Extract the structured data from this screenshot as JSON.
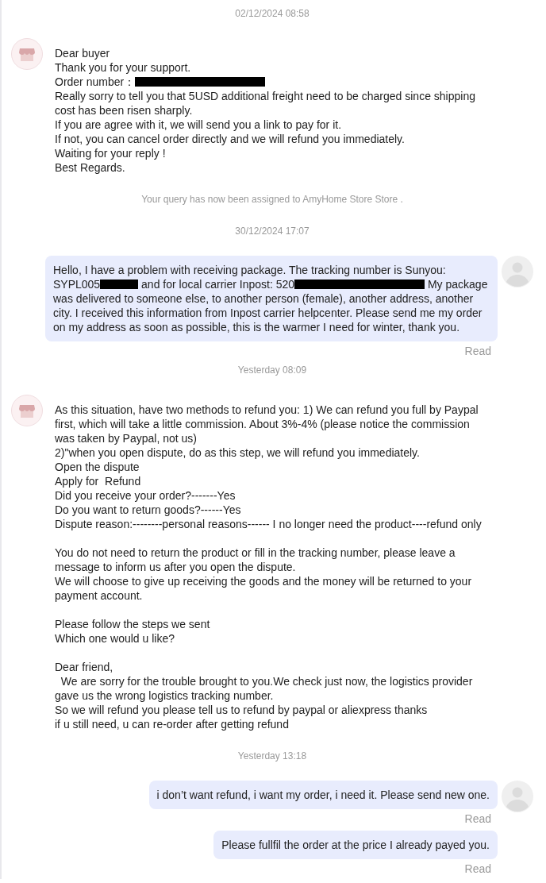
{
  "items": [
    {
      "kind": "timestamp",
      "text": "02/12/2024 08:58"
    },
    {
      "kind": "incoming",
      "paragraphs": [
        [
          "Dear buyer",
          "Thank you for your support.",
          {
            "parts": [
              {
                "kind": "text",
                "text": "Order number："
              },
              {
                "kind": "redaction"
              }
            ]
          },
          "Really sorry to tell you that 5USD additional freight need to be charged since shipping cost has been risen sharply.",
          "If you are agree with it, we will send you a link to pay for it.",
          "If not, you can cancel order directly and we will refund you immediately.",
          "Waiting for your reply !",
          "Best Regards."
        ]
      ]
    },
    {
      "kind": "system",
      "text": "Your query has now been assigned to AmyHome Store Store ."
    },
    {
      "kind": "timestamp",
      "text": "30/12/2024 17:07"
    },
    {
      "kind": "outgoing",
      "status": "Read",
      "paragraphs": [
        [
          "Hello, I have a problem with receiving package. The tracking number is Sunyou:",
          {
            "parts": [
              {
                "kind": "text",
                "text": "SYPL005"
              },
              {
                "kind": "redaction"
              },
              {
                "kind": "text",
                "text": " and for local carrier Inpost: 520"
              },
              {
                "kind": "redaction"
              },
              {
                "kind": "text",
                "text": " My package"
              }
            ]
          },
          "was delivered to someone else, to another person (female), another address, another city. I received this information from Inpost carrier helpcenter. Please send me my order on my address as soon as possible, this is the warmer I need for winter, thank you."
        ]
      ]
    },
    {
      "kind": "timestamp",
      "text": "Yesterday 08:09"
    },
    {
      "kind": "incoming",
      "paragraphs": [
        [
          "As this situation, have two methods to refund you: 1) We can refund you full by Paypal first, which will take a little commission. About 3%-4% (please notice the commission was taken by Paypal, not us)",
          "2)\"when you open dispute, do as this step, we will refund you immediately.",
          "Open the dispute",
          "Apply for  Refund",
          "Did you receive your order?-------Yes",
          "Do you want to return goods?------Yes",
          "Dispute reason:--------personal reasons------ I no longer need the product----refund only"
        ],
        [
          "You do not need to return the product or fill in the tracking number, please leave a message to inform us after you open the dispute.",
          "We will choose to give up receiving the goods and the money will be returned to your payment account."
        ],
        [
          "Please follow the steps we sent",
          "Which one would u like?"
        ],
        [
          "Dear friend,",
          "  We are sorry for the trouble brought to you.We check just now, the logistics provider gave us the wrong logistics tracking number.",
          "So we will refund you please tell us to refund by paypal or aliexpress thanks",
          "if u still need, u can re-order after getting refund"
        ]
      ]
    },
    {
      "kind": "timestamp",
      "text": "Yesterday 13:18"
    },
    {
      "kind": "outgoing",
      "status": "Read",
      "paragraphs": [
        [
          "i don’t want refund, i want my order, i need it. Please send new one."
        ]
      ]
    },
    {
      "kind": "outgoing",
      "status": "Read",
      "paragraphs": [
        [
          "Please fullfil the order at the price I already payed you."
        ]
      ]
    }
  ]
}
